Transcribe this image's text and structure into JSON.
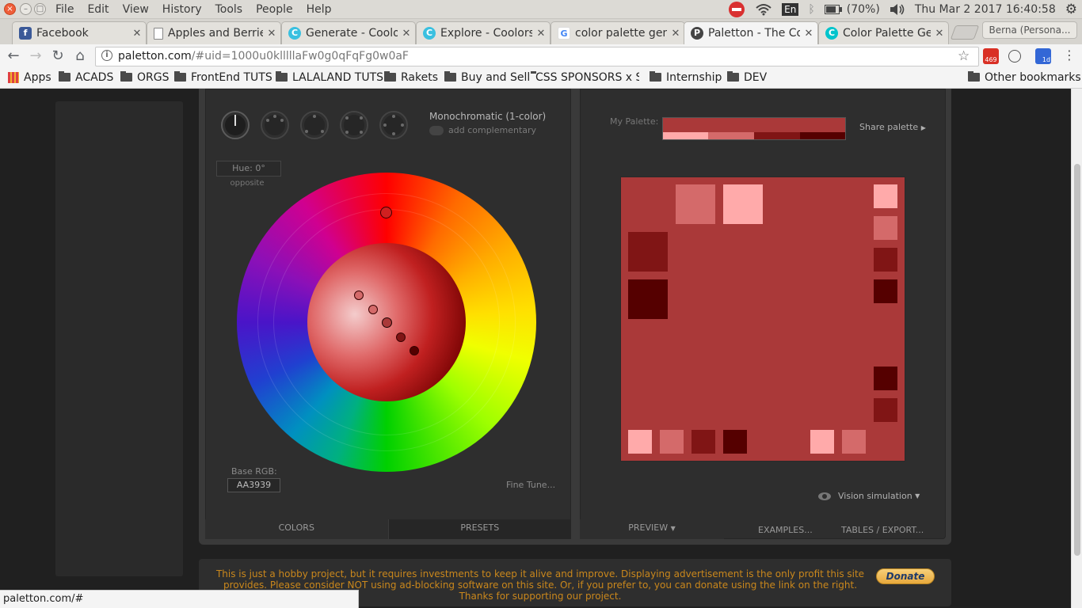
{
  "system": {
    "menus": [
      "File",
      "Edit",
      "View",
      "History",
      "Tools",
      "People",
      "Help"
    ],
    "keyboard": "En",
    "battery": "(70%)",
    "datetime": "Thu Mar  2 2017 16:40:58"
  },
  "tabs": [
    {
      "title": "Facebook",
      "favicon": "facebook-icon",
      "color": "#3b5998",
      "glyph": "f"
    },
    {
      "title": "Apples and Berries",
      "favicon": "page-icon",
      "color": "#888888",
      "glyph": ""
    },
    {
      "title": "Generate - Coolors",
      "favicon": "coolors-icon",
      "color": "#3ac0e0",
      "glyph": "C"
    },
    {
      "title": "Explore - Coolors",
      "favicon": "coolors-icon",
      "color": "#3ac0e0",
      "glyph": "C"
    },
    {
      "title": "color palette generator",
      "favicon": "google-icon",
      "color": "#4285f4",
      "glyph": "G"
    },
    {
      "title": "Paletton - The Color Scheme Designer",
      "favicon": "paletton-icon",
      "color": "#444444",
      "glyph": "P",
      "active": true
    },
    {
      "title": "Color Palette Generator",
      "favicon": "canva-icon",
      "color": "#00c4cc",
      "glyph": "C"
    }
  ],
  "profile": "Berna (Persona...",
  "address": {
    "host": "paletton.com",
    "path": "/#uid=1000u0klllllaFw0g0qFqFg0w0aF"
  },
  "extensions": {
    "gmail_count": "469",
    "ext_badge": "1d"
  },
  "bookmarks": [
    "Apps",
    "ACADS",
    "ORGS",
    "FrontEnd TUTS",
    "LALALAND TUTS",
    "Rakets",
    "Buy and Sell",
    "CSS SPONSORS x SSS",
    "Internship",
    "DEV"
  ],
  "other_bookmarks": "Other bookmarks",
  "paletton": {
    "scheme": "Monochromatic (1-color)",
    "add_complementary": "add complementary",
    "hue": "Hue: 0°",
    "opposite": "opposite",
    "base_rgb_label": "Base RGB:",
    "base_rgb": "AA3939",
    "fine_tune": "Fine Tune...",
    "tab_colors": "COLORS",
    "tab_presets": "PRESETS",
    "my_palette": "My Palette:",
    "share": "Share palette",
    "vision": "Vision simulation",
    "tab_preview": "PREVIEW",
    "tab_examples": "EXAMPLES...",
    "tab_tables": "TABLES / EXPORT...",
    "colors": {
      "base": "#AA3939",
      "light2": "#FFAAAA",
      "light1": "#D46A6A",
      "dark1": "#801515",
      "dark2": "#550000"
    }
  },
  "ad": {
    "text": "This is just a hobby project, but it requires investments to keep it alive and improve. Displaying advertisement is the only profit this site provides. Please consider NOT using ad-blocking software on this site. Or, if you prefer to, you can donate using the link on the right. Thanks for supporting our project.",
    "donate": "Donate"
  },
  "status_url": "paletton.com/#"
}
